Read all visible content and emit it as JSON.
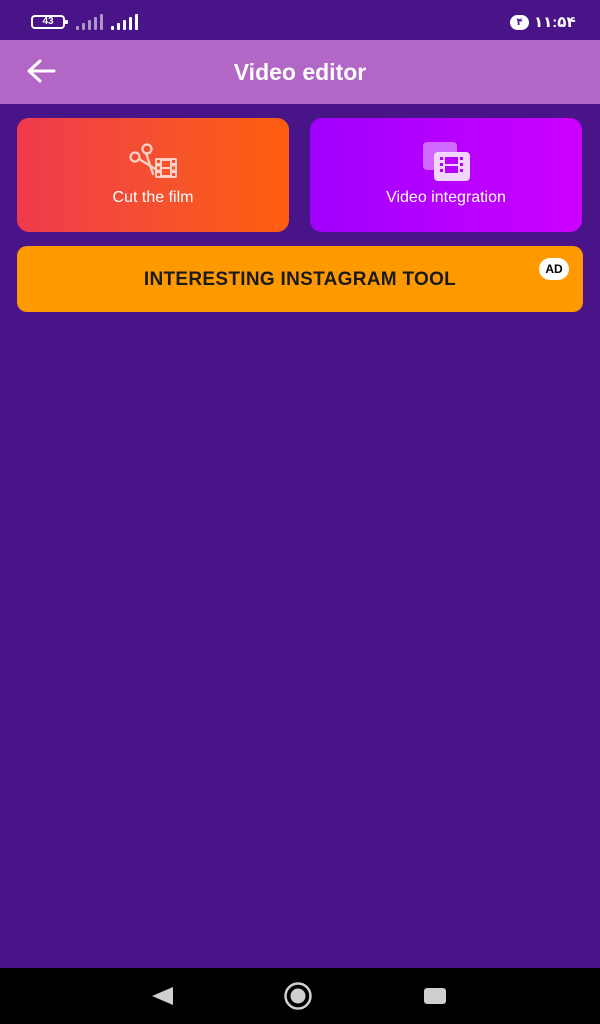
{
  "status_bar": {
    "battery_level": "43",
    "notification_count": "۴",
    "time": "۱۱:۵۴"
  },
  "toolbar": {
    "title": "Video editor",
    "back_icon": "arrow-left-icon"
  },
  "cards": [
    {
      "label": "Cut the film",
      "icon": "scissors-film-icon",
      "gradient": [
        "#f03a4e",
        "#ff5e0f"
      ]
    },
    {
      "label": "Video integration",
      "icon": "film-stack-icon",
      "gradient": [
        "#a000ff",
        "#cc00ff"
      ]
    }
  ],
  "banner": {
    "label": "INTERESTING INSTAGRAM TOOL",
    "badge": "AD",
    "color": "#ff9900"
  },
  "nav_bar": {
    "back_icon": "triangle-back-icon",
    "home_icon": "circle-home-icon",
    "recents_icon": "square-recents-icon"
  },
  "colors": {
    "background": "#4a1489",
    "toolbar": "#b266c6"
  }
}
